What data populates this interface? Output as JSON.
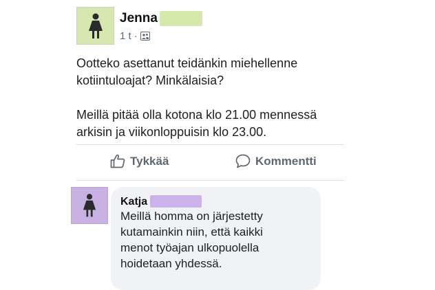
{
  "post": {
    "author_name": "Jenna",
    "timestamp": "1 t",
    "separator": "·",
    "audience_icon": "friends-icon",
    "avatar_icon": "female-figure-icon",
    "avatar_color": "#d6e7b0",
    "redaction_color": "#d6e9ad",
    "body_paragraph_1_line_1": "Ootteko asettanut teidänkin miehellenne",
    "body_paragraph_1_line_2": "kotiintuloajat? Minkälaisia?",
    "body_paragraph_2_line_1": "Meillä pitää olla kotona klo 21.00 mennessä",
    "body_paragraph_2_line_2": "arkisin ja viikonloppuisin klo 23.00."
  },
  "actions": {
    "like_label": "Tykkää",
    "like_icon": "thumbs-up-icon",
    "comment_label": "Kommentti",
    "comment_icon": "speech-bubble-icon"
  },
  "comment": {
    "author_name": "Katja",
    "avatar_icon": "female-figure-icon",
    "avatar_color": "#c7b2e2",
    "redaction_color": "#c9b3e8",
    "text_line_1": "Meillä homma on järjestetty",
    "text_line_2": "kutamainkin niin, että kaikki",
    "text_line_3": "menot työajan ulkopuolella",
    "text_line_4": "hoidetaan yhdessä."
  }
}
